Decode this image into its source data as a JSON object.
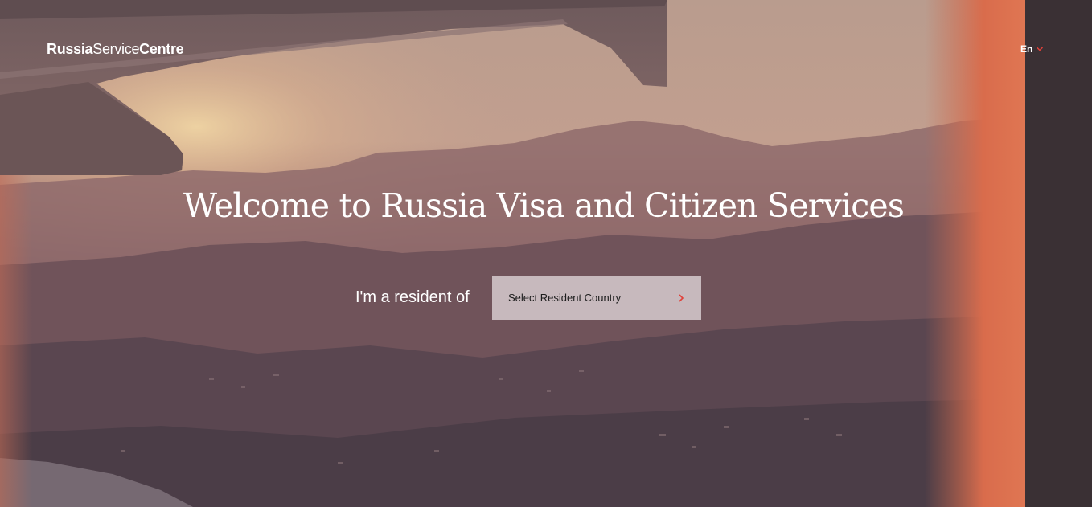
{
  "header": {
    "logo": {
      "part1": "Russia",
      "part2": "Service",
      "part3": "Centre"
    },
    "language": {
      "label": "En"
    }
  },
  "hero": {
    "title": "Welcome to Russia Visa and Citizen Services",
    "resident_label": "I'm a resident of",
    "country_select": {
      "placeholder": "Select Resident Country"
    }
  },
  "colors": {
    "accent": "#e0413a",
    "select_background": "#d0c4c8",
    "text_on_image": "#ffffff"
  }
}
